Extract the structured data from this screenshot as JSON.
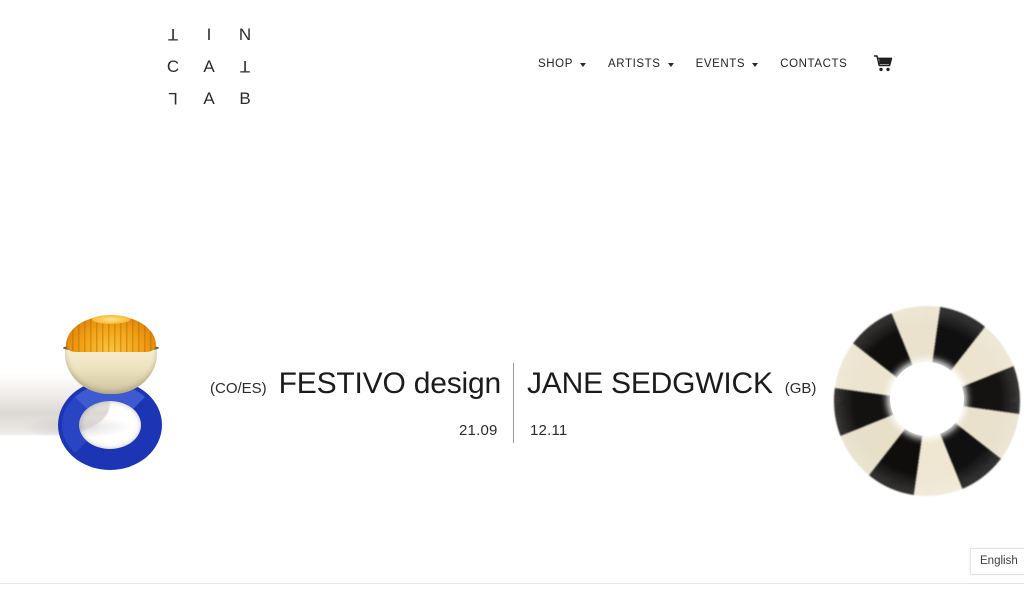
{
  "site": {
    "brand_name": "TIN CAT LAB",
    "logo_grid": [
      [
        {
          "char": "T",
          "flipped": true
        },
        {
          "char": "I",
          "flipped": false
        },
        {
          "char": "N",
          "flipped": false
        }
      ],
      [
        {
          "char": "C",
          "flipped": false
        },
        {
          "char": "A",
          "flipped": false
        },
        {
          "char": "T",
          "flipped": true
        }
      ],
      [
        {
          "char": "L",
          "flipped": true
        },
        {
          "char": "A",
          "flipped": false
        },
        {
          "char": "B",
          "flipped": false
        }
      ]
    ]
  },
  "nav": {
    "items": [
      {
        "label": "SHOP",
        "has_dropdown": true
      },
      {
        "label": "ARTISTS",
        "has_dropdown": true
      },
      {
        "label": "EVENTS",
        "has_dropdown": true
      },
      {
        "label": "CONTACTS",
        "has_dropdown": false
      }
    ],
    "cart_icon": "shopping-cart-icon"
  },
  "hero": {
    "left_event": {
      "country": "(CO/ES)",
      "name": "FESTIVO design",
      "date": "21.09",
      "artwork": {
        "name": "blue-ring-with-gold-dome",
        "ring_color": "#1b35b5",
        "dome_color": "#f2a417",
        "base_color": "#ece2bd"
      }
    },
    "right_event": {
      "country": "(GB)",
      "name": "JANE SEDGWICK",
      "date": "12.11",
      "artwork": {
        "name": "black-and-cream-fur-wreath",
        "dark_color": "#111010",
        "light_color": "#ece4cf"
      }
    },
    "divider_color": "#9a9a9a"
  },
  "footer": {
    "language": "English",
    "rule_color": "#e6e6e6"
  }
}
